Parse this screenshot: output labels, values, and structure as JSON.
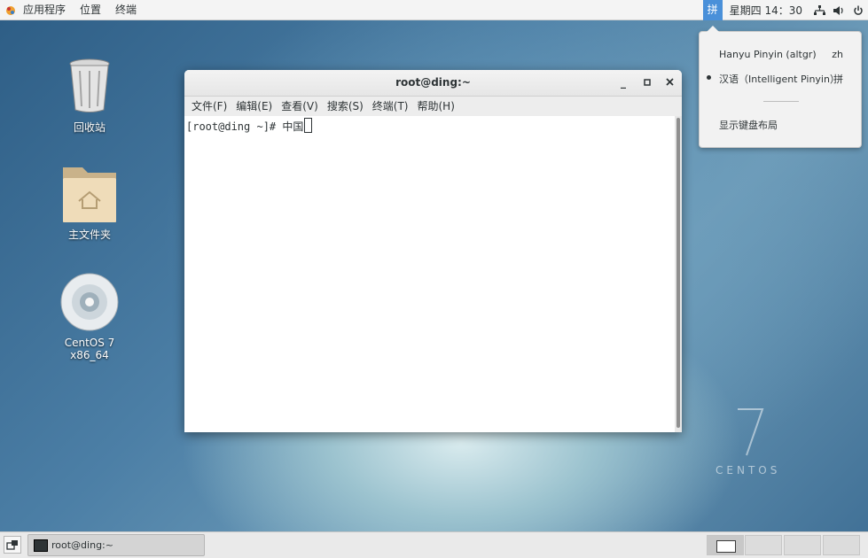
{
  "topbar": {
    "applications": "应用程序",
    "places": "位置",
    "terminal": "终端",
    "ime_indicator": "拼",
    "clock": "星期四 14：30"
  },
  "desktop": {
    "trash": "回收站",
    "home": "主文件夹",
    "disc": "CentOS 7 x86_64"
  },
  "ime_popup": {
    "items": [
      {
        "name": "Hanyu Pinyin (altgr)",
        "code": "zh"
      },
      {
        "name": "汉语（Intelligent Pinyin）",
        "code": "拼"
      }
    ],
    "layout_link": "显示键盘布局"
  },
  "terminal": {
    "title": "root@ding:~",
    "menu": [
      "文件(F)",
      "编辑(E)",
      "查看(V)",
      "搜索(S)",
      "终端(T)",
      "帮助(H)"
    ],
    "prompt": "[root@ding ~]# 中国"
  },
  "watermark": {
    "seven": "7",
    "word": "CENTOS"
  },
  "taskbar": {
    "task_label": "root@ding:~"
  }
}
